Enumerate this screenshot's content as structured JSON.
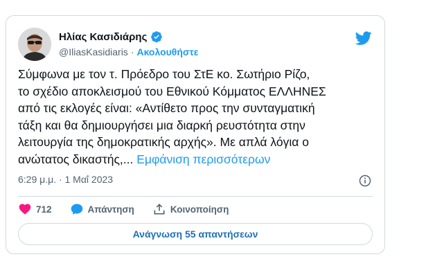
{
  "author": {
    "name": "Ηλίας Κασιδιάρης",
    "handle": "@IliasKasidiaris",
    "separator": "·",
    "follow_label": "Ακολουθήστε"
  },
  "tweet": {
    "text": "Σύμφωνα με τον τ. Πρόεδρο του ΣτΕ κο. Σωτήριο Ρίζο,\nτο σχέδιο αποκλεισμού του Εθνικού Κόμματος ΕΛΛΗΝΕΣ\nαπό τις εκλογές είναι: «Αντίθετο προς την συνταγματική\nτάξη και θα δημιουργήσει μια διαρκή ρευστότητα στην\nλειτουργία της δημοκρατικής αρχής». Με απλά λόγια ο\nανώτατος δικαστής,... ",
    "show_more": "Εμφάνιση περισσότερων",
    "timestamp": "6:29 μ.μ. · 1 Μαΐ 2023"
  },
  "actions": {
    "like_count": "712",
    "reply_label": "Απάντηση",
    "share_label": "Κοινοποίηση"
  },
  "read_replies_label": "Ανάγνωση 55 απαντήσεων",
  "icons": {
    "bird": "twitter-bird-icon",
    "verified": "verified-badge-icon",
    "info": "info-icon",
    "heart": "heart-icon",
    "reply": "reply-bubble-icon",
    "share": "share-icon"
  },
  "colors": {
    "accent": "#1d9bf0",
    "like": "#f91880",
    "muted": "#536471"
  }
}
